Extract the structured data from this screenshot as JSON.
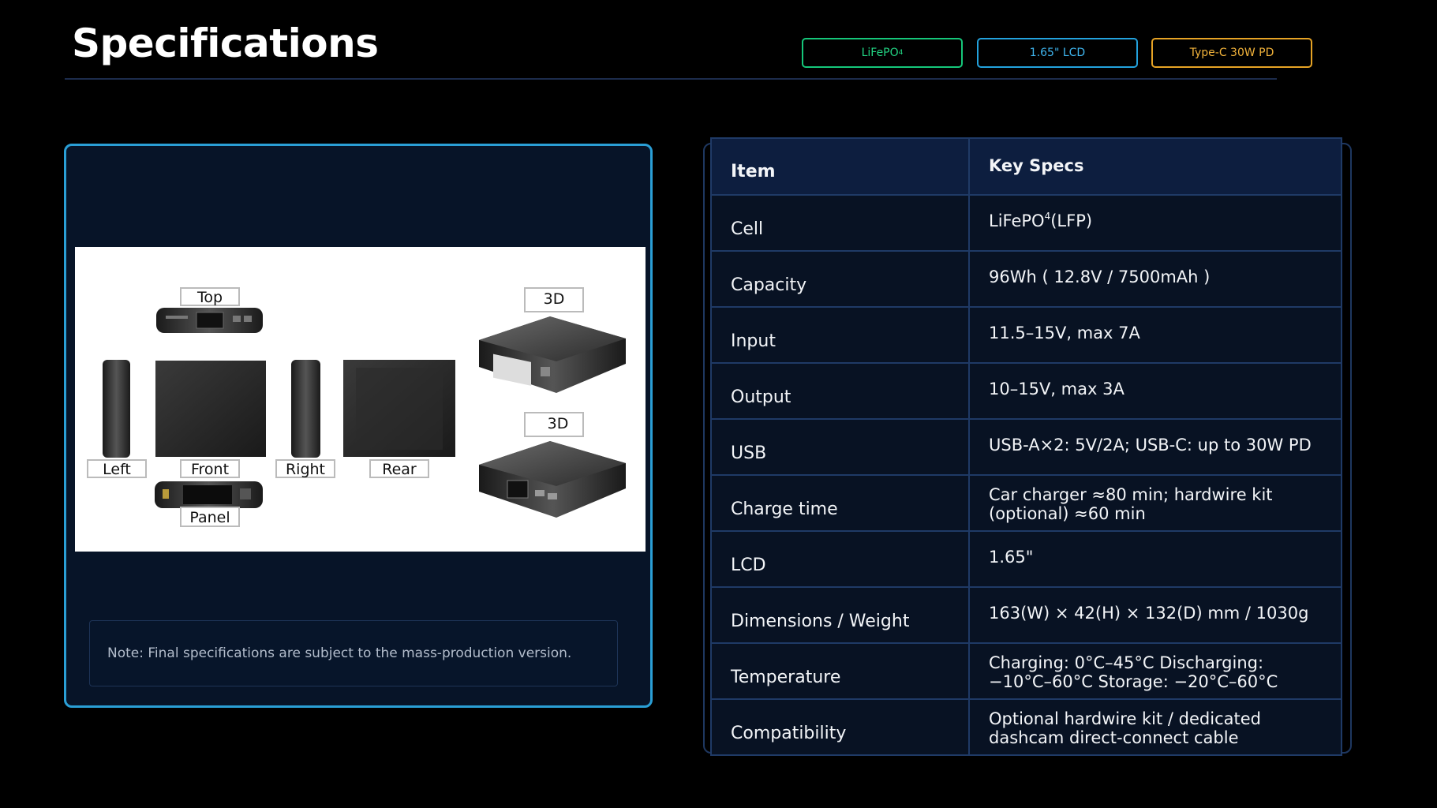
{
  "page": {
    "title": "Specifications",
    "tags": [
      {
        "label": "LiFePO",
        "sub": "4",
        "color": "#15c77a"
      },
      {
        "label": "1.65\" LCD",
        "color": "#23a2dd"
      },
      {
        "label": "Type-C 30W PD",
        "color": "#e6a325"
      }
    ]
  },
  "product_views": {
    "labels": {
      "top": "Top",
      "left": "Left",
      "front": "Front",
      "right": "Right",
      "rear": "Rear",
      "panel": "Panel",
      "three_d_1": "3D",
      "three_d_2": "3D"
    },
    "note": "Note: Final specifications are subject to the mass-production version."
  },
  "spec_table": {
    "header": {
      "item": "Item",
      "spec": "Key Specs"
    },
    "rows": [
      {
        "item": "Cell",
        "spec": "LiFePO",
        "spec_sub": "4",
        "spec_after": " (LFP)"
      },
      {
        "item": "Capacity",
        "spec": "96Wh ( 12.8V / 7500mAh )"
      },
      {
        "item": "Input",
        "spec": "11.5–15V, max 7A"
      },
      {
        "item": "Output",
        "spec": "10–15V, max 3A"
      },
      {
        "item": "USB",
        "spec": "USB-A×2: 5V/2A;  USB-C: up to 30W PD"
      },
      {
        "item": "Charge time",
        "spec": "Car charger ≈80 min; hardwire kit (optional) ≈60 min"
      },
      {
        "item": "LCD",
        "spec": "1.65\""
      },
      {
        "item": "Dimensions / Weight",
        "spec": "163(W) × 42(H) × 132(D) mm / 1030g"
      },
      {
        "item": "Temperature",
        "spec": "Charging: 0°C–45°C   Discharging: −10°C–60°C   Storage: −20°C–60°C"
      },
      {
        "item": "Compatibility",
        "spec": "Optional hardwire kit / dedicated dashcam direct-connect cable"
      }
    ]
  }
}
